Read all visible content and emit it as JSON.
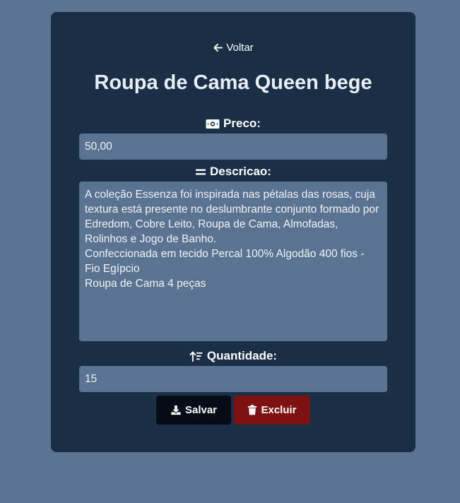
{
  "back": {
    "label": "Voltar",
    "icon": "arrow-left-icon"
  },
  "product": {
    "title": "Roupa de Cama Queen bege"
  },
  "form": {
    "price": {
      "label": "Preco:",
      "icon": "money-bill-icon",
      "value": "50,00"
    },
    "description": {
      "label": "Descricao:",
      "icon": "equals-icon",
      "value": "A coleção Essenza foi inspirada nas pétalas das rosas, cuja textura está presente no deslumbrante conjunto formado por Edredom, Cobre Leito, Roupa de Cama, Almofadas, Rolinhos e Jogo de Banho.\nConfeccionada em tecido Percal 100% Algodão 400 fios - Fio Egípcio\nRoupa de Cama 4 peças"
    },
    "quantity": {
      "label": "Quantidade:",
      "icon": "sort-amount-up-icon",
      "value": "15"
    }
  },
  "actions": {
    "save": {
      "label": "Salvar",
      "icon": "download-icon"
    },
    "delete": {
      "label": "Excluir",
      "icon": "trash-icon"
    }
  },
  "colors": {
    "page_bg": "#5a7391",
    "card_bg": "#1a2e46",
    "input_bg": "#5a7391",
    "save_bg": "#050c15",
    "delete_bg": "#7e1212"
  }
}
